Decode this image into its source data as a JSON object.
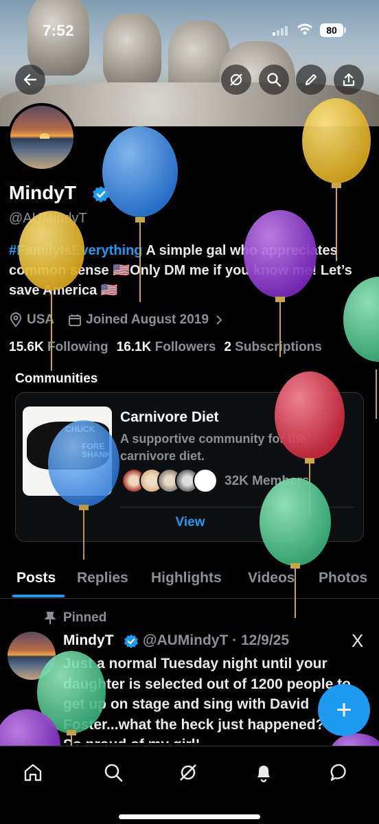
{
  "status_bar": {
    "time": "7:52",
    "battery": "80"
  },
  "header": {
    "back_icon": "arrow-left-icon",
    "grok_icon": "grok-icon",
    "search_icon": "search-icon",
    "edit_icon": "pencil-icon",
    "share_icon": "share-icon"
  },
  "profile": {
    "name": "MindyT",
    "handle": "@AUMindyT",
    "bio_hashtag": "#FamilyIsEverything",
    "bio_text": " A simple gal who appreciates common sense 🇺🇸Only DM me if you know me! Let’s save America 🇺🇸",
    "location": "USA",
    "joined": "Joined August 2019",
    "following_count": "15.6K",
    "following_label": "Following",
    "followers_count": "16.1K",
    "followers_label": "Followers",
    "subscriptions_count": "2",
    "subscriptions_label": "Subscriptions"
  },
  "communities": {
    "heading": "Communities",
    "card": {
      "title": "Carnivore Diet",
      "description": "A supportive community for the carnivore diet.",
      "members": "32K Members",
      "view_label": "View",
      "image_text_1": "CHUCK",
      "image_text_2": "FORE SHANK"
    }
  },
  "tabs": [
    "Posts",
    "Replies",
    "Highlights",
    "Videos",
    "Photos"
  ],
  "post": {
    "pinned_label": "Pinned",
    "author": "MindyT",
    "meta": "@AUMindyT · 12/9/25",
    "x_icon": "X",
    "text": "Just a normal Tuesday night until your daughter is selected out of 1200 people to get up on stage and sing with David Foster...what the heck just happened??!? So proud of my girl!"
  },
  "fab_label": "+",
  "bottom_nav": [
    "home-icon",
    "search-icon",
    "grok-icon",
    "notifications-icon",
    "messages-icon"
  ],
  "colors": {
    "accent": "#1d9bf0",
    "background": "#000000",
    "muted": "#8b9096"
  }
}
